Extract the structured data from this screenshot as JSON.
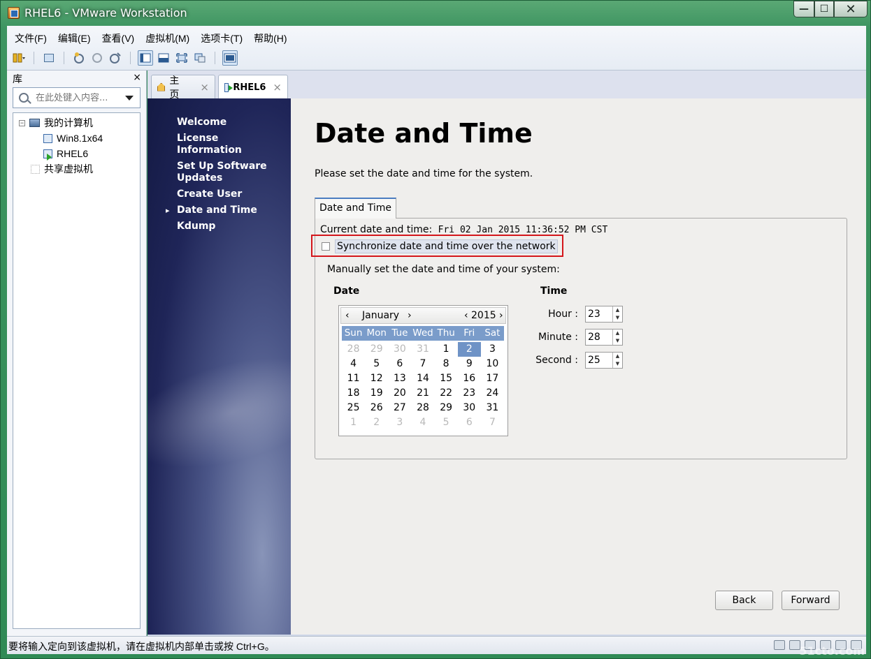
{
  "window": {
    "title": "RHEL6 - VMware Workstation"
  },
  "menubar": [
    "文件(F)",
    "编辑(E)",
    "查看(V)",
    "虚拟机(M)",
    "选项卡(T)",
    "帮助(H)"
  ],
  "toolbar": [
    "pause-icon",
    "snapshot-icon",
    "revert-icon",
    "snapshot-manager-icon",
    "console-view-icon",
    "unity-icon",
    "fullscreen-icon",
    "thumbnail-icon",
    "stretch-icon"
  ],
  "library": {
    "title": "库",
    "close": "×",
    "search_placeholder": "在此处键入内容...",
    "tree": {
      "root": "我的计算机",
      "vms": [
        "Win8.1x64",
        "RHEL6"
      ],
      "shared": "共享虚拟机"
    }
  },
  "tabs": [
    {
      "label": "主页",
      "close": "×"
    },
    {
      "label": "RHEL6",
      "close": "×"
    }
  ],
  "firstboot": {
    "steps": [
      "Welcome",
      "License Information",
      "Set Up Software Updates",
      "Create User",
      "Date and Time",
      "Kdump"
    ],
    "current_step": "Date and Time",
    "title": "Date and Time",
    "description": "Please set the date and time for the system.",
    "tab_label": "Date and Time",
    "current_label": "Current date and time:",
    "current_value": "Fri 02 Jan 2015 11:36:52 PM CST",
    "sync_label": "Synchronize date and time over the network",
    "sync_checked": false,
    "manual_label": "Manually set the date and time of your system:",
    "date_heading": "Date",
    "time_heading": "Time",
    "calendar": {
      "month": "January",
      "year": "2015",
      "weekdays": [
        "Sun",
        "Mon",
        "Tue",
        "Wed",
        "Thu",
        "Fri",
        "Sat"
      ],
      "weeks": [
        [
          "28",
          "29",
          "30",
          "31",
          "1",
          "2",
          "3"
        ],
        [
          "4",
          "5",
          "6",
          "7",
          "8",
          "9",
          "10"
        ],
        [
          "11",
          "12",
          "13",
          "14",
          "15",
          "16",
          "17"
        ],
        [
          "18",
          "19",
          "20",
          "21",
          "22",
          "23",
          "24"
        ],
        [
          "25",
          "26",
          "27",
          "28",
          "29",
          "30",
          "31"
        ],
        [
          "1",
          "2",
          "3",
          "4",
          "5",
          "6",
          "7"
        ]
      ],
      "selected": "2"
    },
    "time": {
      "hour_label": "Hour :",
      "hour": "23",
      "minute_label": "Minute :",
      "minute": "28",
      "second_label": "Second :",
      "second": "25"
    },
    "back_label": "Back",
    "forward_label": "Forward"
  },
  "statusbar": {
    "text": "要将输入定向到该虚拟机，请在虚拟机内部单击或按 Ctrl+G。"
  },
  "watermark": "51cto.com",
  "colors": {
    "highlight": "#d4161b",
    "selected_day": "#6f93c6",
    "weekday_bar": "#7a9cca"
  }
}
